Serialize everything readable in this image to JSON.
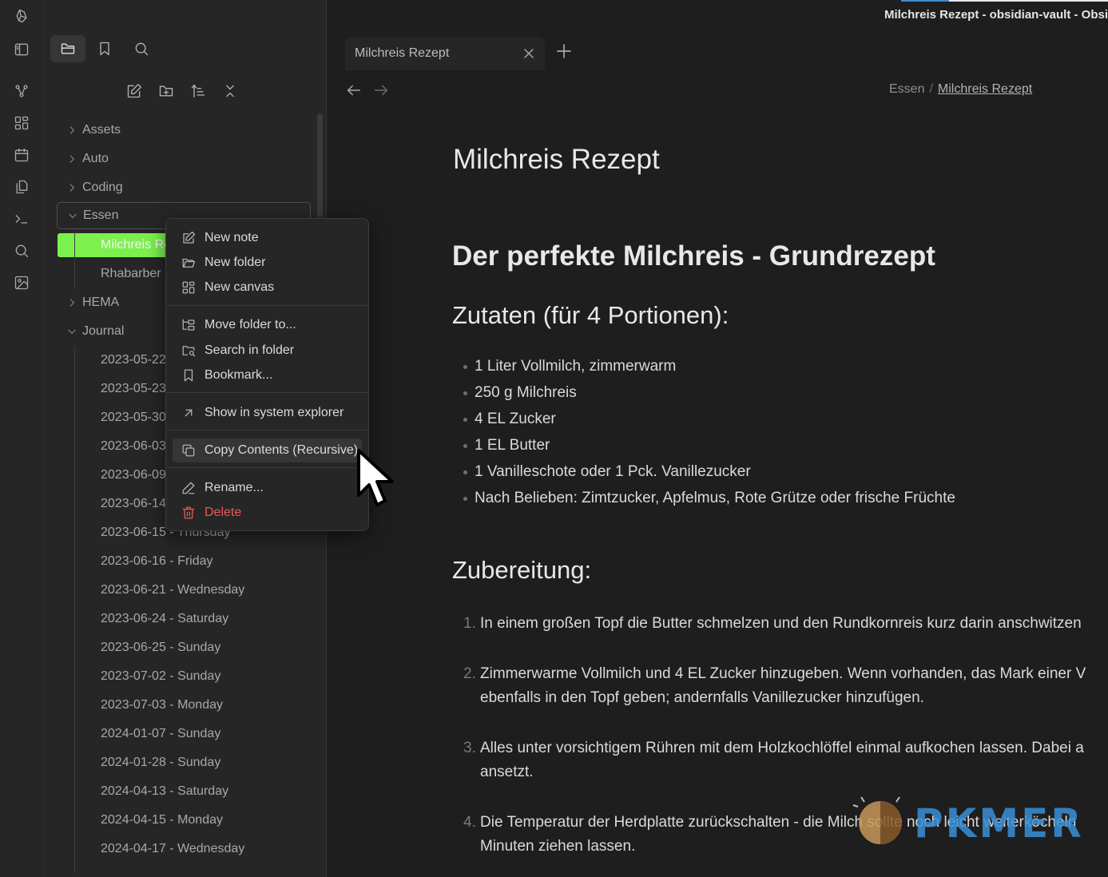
{
  "window": {
    "title": "Milchreis Rezept - obsidian-vault - Obsi"
  },
  "tabs": [
    {
      "label": "Milchreis Rezept"
    }
  ],
  "breadcrumb": {
    "parent": "Essen",
    "separator": "/",
    "current": "Milchreis Rezept"
  },
  "ribbon": {
    "icons": [
      "obsidian-logo-icon",
      "sidebar-toggle-icon",
      "graph-icon",
      "canvas-icon",
      "calendar-icon",
      "copy-files-icon",
      "terminal-icon",
      "search-icon",
      "image-icon"
    ]
  },
  "sidebar": {
    "tabs": [
      "files-icon",
      "bookmark-icon",
      "search-icon"
    ],
    "actions": [
      "new-note-icon",
      "new-folder-icon",
      "sort-icon",
      "collapse-all-icon"
    ],
    "tree": [
      {
        "label": "Assets",
        "type": "folder",
        "expanded": false
      },
      {
        "label": "Auto",
        "type": "folder",
        "expanded": false
      },
      {
        "label": "Coding",
        "type": "folder",
        "expanded": false
      },
      {
        "label": "Essen",
        "type": "folder",
        "expanded": true
      },
      {
        "label": "Milchreis Re",
        "type": "file",
        "active": true
      },
      {
        "label": "Rhabarber I",
        "type": "file"
      },
      {
        "label": "HEMA",
        "type": "folder",
        "expanded": false
      },
      {
        "label": "Journal",
        "type": "folder",
        "expanded": true
      },
      {
        "label": "2023-05-22",
        "type": "file"
      },
      {
        "label": "2023-05-23",
        "type": "file"
      },
      {
        "label": "2023-05-30",
        "type": "file"
      },
      {
        "label": "2023-06-03",
        "type": "file"
      },
      {
        "label": "2023-06-09",
        "type": "file"
      },
      {
        "label": "2023-06-14",
        "type": "file"
      },
      {
        "label": "2023-06-15 - Thursday",
        "type": "file"
      },
      {
        "label": "2023-06-16 - Friday",
        "type": "file"
      },
      {
        "label": "2023-06-21 - Wednesday",
        "type": "file"
      },
      {
        "label": "2023-06-24 - Saturday",
        "type": "file"
      },
      {
        "label": "2023-06-25 - Sunday",
        "type": "file"
      },
      {
        "label": "2023-07-02 - Sunday",
        "type": "file"
      },
      {
        "label": "2023-07-03 - Monday",
        "type": "file"
      },
      {
        "label": "2024-01-07 - Sunday",
        "type": "file"
      },
      {
        "label": "2024-01-28 - Sunday",
        "type": "file"
      },
      {
        "label": "2024-04-13 - Saturday",
        "type": "file"
      },
      {
        "label": "2024-04-15 - Monday",
        "type": "file"
      },
      {
        "label": "2024-04-17 - Wednesday",
        "type": "file"
      }
    ]
  },
  "context_menu": {
    "groups": [
      [
        {
          "label": "New note",
          "icon": "edit-icon"
        },
        {
          "label": "New folder",
          "icon": "folder-open-icon"
        },
        {
          "label": "New canvas",
          "icon": "canvas-icon"
        }
      ],
      [
        {
          "label": "Move folder to...",
          "icon": "move-folder-icon"
        },
        {
          "label": "Search in folder",
          "icon": "folder-search-icon"
        },
        {
          "label": "Bookmark...",
          "icon": "bookmark-icon"
        }
      ],
      [
        {
          "label": "Show in system explorer",
          "icon": "arrow-up-right-icon"
        }
      ],
      [
        {
          "label": "Copy Contents (Recursive)",
          "icon": "copy-icon",
          "hovered": true
        }
      ],
      [
        {
          "label": "Rename...",
          "icon": "pencil-icon"
        },
        {
          "label": "Delete",
          "icon": "trash-icon",
          "danger": true
        }
      ]
    ]
  },
  "note": {
    "title": "Milchreis Rezept",
    "heading": "Der perfekte Milchreis - Grundrezept",
    "ingredients_heading": "Zutaten (für 4 Portionen):",
    "ingredients": [
      "1 Liter Vollmilch, zimmerwarm",
      "250 g Milchreis",
      "4 EL Zucker",
      "1 EL Butter",
      "1 Vanilleschote oder 1 Pck. Vanillezucker",
      "Nach Belieben: Zimtzucker, Apfelmus, Rote Grütze oder frische Früchte"
    ],
    "steps_heading": "Zubereitung:",
    "steps": [
      {
        "num": "1.",
        "line1": "In einem großen Topf die Butter schmelzen und den Rundkornreis kurz darin anschwitzen",
        "line2": ""
      },
      {
        "num": "2.",
        "line1": "Zimmerwarme Vollmilch und 4 EL Zucker hinzugeben. Wenn vorhanden, das Mark einer V",
        "line2": "ebenfalls in den Topf geben; andernfalls Vanillezucker hinzufügen."
      },
      {
        "num": "3.",
        "line1": "Alles unter vorsichtigem Rühren mit dem Holzkochlöffel einmal aufkochen lassen. Dabei a",
        "line2": "ansetzt."
      },
      {
        "num": "4.",
        "line1": "Die Temperatur der Herdplatte zurückschalten - die Milch sollte noch leicht weiterköcheln",
        "line2": "Minuten ziehen lassen."
      }
    ]
  },
  "watermark": {
    "text": "PKMER"
  },
  "colors": {
    "accent_file_highlight": "#7cf14d",
    "danger": "#f05757",
    "watermark": "#3a8fd8"
  }
}
